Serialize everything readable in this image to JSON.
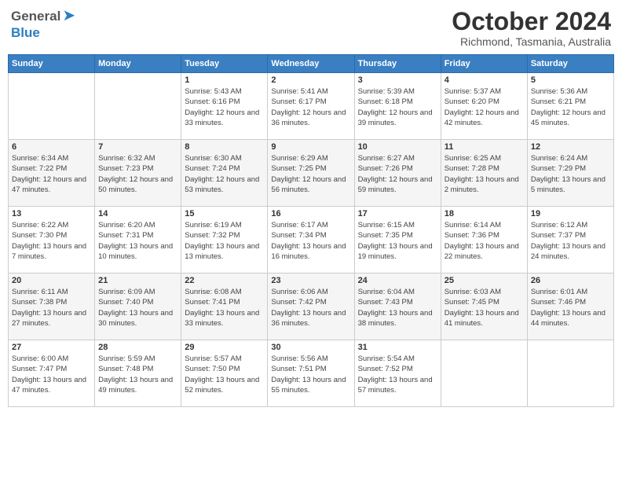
{
  "header": {
    "logo": {
      "general": "General",
      "blue": "Blue"
    },
    "title": "October 2024",
    "location": "Richmond, Tasmania, Australia"
  },
  "weekdays": [
    "Sunday",
    "Monday",
    "Tuesday",
    "Wednesday",
    "Thursday",
    "Friday",
    "Saturday"
  ],
  "weeks": [
    [
      {
        "day": "",
        "sunrise": "",
        "sunset": "",
        "daylight": ""
      },
      {
        "day": "",
        "sunrise": "",
        "sunset": "",
        "daylight": ""
      },
      {
        "day": "1",
        "sunrise": "Sunrise: 5:43 AM",
        "sunset": "Sunset: 6:16 PM",
        "daylight": "Daylight: 12 hours and 33 minutes."
      },
      {
        "day": "2",
        "sunrise": "Sunrise: 5:41 AM",
        "sunset": "Sunset: 6:17 PM",
        "daylight": "Daylight: 12 hours and 36 minutes."
      },
      {
        "day": "3",
        "sunrise": "Sunrise: 5:39 AM",
        "sunset": "Sunset: 6:18 PM",
        "daylight": "Daylight: 12 hours and 39 minutes."
      },
      {
        "day": "4",
        "sunrise": "Sunrise: 5:37 AM",
        "sunset": "Sunset: 6:20 PM",
        "daylight": "Daylight: 12 hours and 42 minutes."
      },
      {
        "day": "5",
        "sunrise": "Sunrise: 5:36 AM",
        "sunset": "Sunset: 6:21 PM",
        "daylight": "Daylight: 12 hours and 45 minutes."
      }
    ],
    [
      {
        "day": "6",
        "sunrise": "Sunrise: 6:34 AM",
        "sunset": "Sunset: 7:22 PM",
        "daylight": "Daylight: 12 hours and 47 minutes."
      },
      {
        "day": "7",
        "sunrise": "Sunrise: 6:32 AM",
        "sunset": "Sunset: 7:23 PM",
        "daylight": "Daylight: 12 hours and 50 minutes."
      },
      {
        "day": "8",
        "sunrise": "Sunrise: 6:30 AM",
        "sunset": "Sunset: 7:24 PM",
        "daylight": "Daylight: 12 hours and 53 minutes."
      },
      {
        "day": "9",
        "sunrise": "Sunrise: 6:29 AM",
        "sunset": "Sunset: 7:25 PM",
        "daylight": "Daylight: 12 hours and 56 minutes."
      },
      {
        "day": "10",
        "sunrise": "Sunrise: 6:27 AM",
        "sunset": "Sunset: 7:26 PM",
        "daylight": "Daylight: 12 hours and 59 minutes."
      },
      {
        "day": "11",
        "sunrise": "Sunrise: 6:25 AM",
        "sunset": "Sunset: 7:28 PM",
        "daylight": "Daylight: 13 hours and 2 minutes."
      },
      {
        "day": "12",
        "sunrise": "Sunrise: 6:24 AM",
        "sunset": "Sunset: 7:29 PM",
        "daylight": "Daylight: 13 hours and 5 minutes."
      }
    ],
    [
      {
        "day": "13",
        "sunrise": "Sunrise: 6:22 AM",
        "sunset": "Sunset: 7:30 PM",
        "daylight": "Daylight: 13 hours and 7 minutes."
      },
      {
        "day": "14",
        "sunrise": "Sunrise: 6:20 AM",
        "sunset": "Sunset: 7:31 PM",
        "daylight": "Daylight: 13 hours and 10 minutes."
      },
      {
        "day": "15",
        "sunrise": "Sunrise: 6:19 AM",
        "sunset": "Sunset: 7:32 PM",
        "daylight": "Daylight: 13 hours and 13 minutes."
      },
      {
        "day": "16",
        "sunrise": "Sunrise: 6:17 AM",
        "sunset": "Sunset: 7:34 PM",
        "daylight": "Daylight: 13 hours and 16 minutes."
      },
      {
        "day": "17",
        "sunrise": "Sunrise: 6:15 AM",
        "sunset": "Sunset: 7:35 PM",
        "daylight": "Daylight: 13 hours and 19 minutes."
      },
      {
        "day": "18",
        "sunrise": "Sunrise: 6:14 AM",
        "sunset": "Sunset: 7:36 PM",
        "daylight": "Daylight: 13 hours and 22 minutes."
      },
      {
        "day": "19",
        "sunrise": "Sunrise: 6:12 AM",
        "sunset": "Sunset: 7:37 PM",
        "daylight": "Daylight: 13 hours and 24 minutes."
      }
    ],
    [
      {
        "day": "20",
        "sunrise": "Sunrise: 6:11 AM",
        "sunset": "Sunset: 7:38 PM",
        "daylight": "Daylight: 13 hours and 27 minutes."
      },
      {
        "day": "21",
        "sunrise": "Sunrise: 6:09 AM",
        "sunset": "Sunset: 7:40 PM",
        "daylight": "Daylight: 13 hours and 30 minutes."
      },
      {
        "day": "22",
        "sunrise": "Sunrise: 6:08 AM",
        "sunset": "Sunset: 7:41 PM",
        "daylight": "Daylight: 13 hours and 33 minutes."
      },
      {
        "day": "23",
        "sunrise": "Sunrise: 6:06 AM",
        "sunset": "Sunset: 7:42 PM",
        "daylight": "Daylight: 13 hours and 36 minutes."
      },
      {
        "day": "24",
        "sunrise": "Sunrise: 6:04 AM",
        "sunset": "Sunset: 7:43 PM",
        "daylight": "Daylight: 13 hours and 38 minutes."
      },
      {
        "day": "25",
        "sunrise": "Sunrise: 6:03 AM",
        "sunset": "Sunset: 7:45 PM",
        "daylight": "Daylight: 13 hours and 41 minutes."
      },
      {
        "day": "26",
        "sunrise": "Sunrise: 6:01 AM",
        "sunset": "Sunset: 7:46 PM",
        "daylight": "Daylight: 13 hours and 44 minutes."
      }
    ],
    [
      {
        "day": "27",
        "sunrise": "Sunrise: 6:00 AM",
        "sunset": "Sunset: 7:47 PM",
        "daylight": "Daylight: 13 hours and 47 minutes."
      },
      {
        "day": "28",
        "sunrise": "Sunrise: 5:59 AM",
        "sunset": "Sunset: 7:48 PM",
        "daylight": "Daylight: 13 hours and 49 minutes."
      },
      {
        "day": "29",
        "sunrise": "Sunrise: 5:57 AM",
        "sunset": "Sunset: 7:50 PM",
        "daylight": "Daylight: 13 hours and 52 minutes."
      },
      {
        "day": "30",
        "sunrise": "Sunrise: 5:56 AM",
        "sunset": "Sunset: 7:51 PM",
        "daylight": "Daylight: 13 hours and 55 minutes."
      },
      {
        "day": "31",
        "sunrise": "Sunrise: 5:54 AM",
        "sunset": "Sunset: 7:52 PM",
        "daylight": "Daylight: 13 hours and 57 minutes."
      },
      {
        "day": "",
        "sunrise": "",
        "sunset": "",
        "daylight": ""
      },
      {
        "day": "",
        "sunrise": "",
        "sunset": "",
        "daylight": ""
      }
    ]
  ]
}
